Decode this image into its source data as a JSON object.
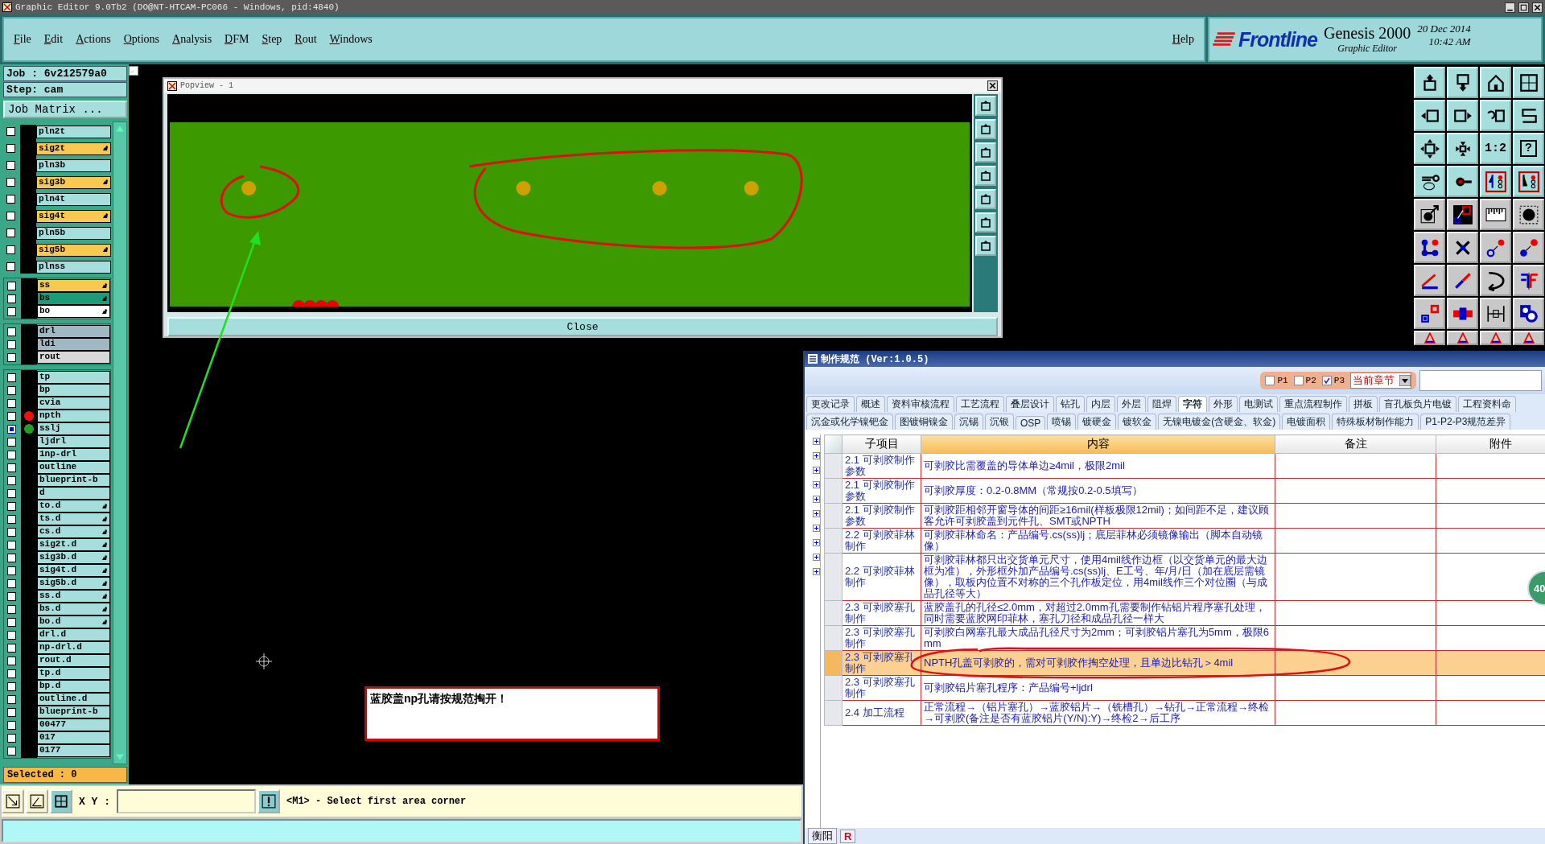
{
  "title_bar": {
    "title": "Graphic Editor 9.0Tb2 (DO@NT-HTCAM-PC066 - Windows, pid:4840)"
  },
  "menu": [
    "File",
    "Edit",
    "Actions",
    "Options",
    "Analysis",
    "DFM",
    "Step",
    "Rout",
    "Windows"
  ],
  "help": "Help",
  "brand": {
    "logo": "Frontline",
    "product": "Genesis 2000",
    "subtitle": "Graphic Editor",
    "date": "20 Dec 2014",
    "time": "10:42 AM"
  },
  "job_panel": {
    "job": "Job : 6v212579a0",
    "step": "Step: cam",
    "matrix_button": "Job Matrix ...",
    "selected": "Selected : 0"
  },
  "layer_groups": [
    {
      "spaced": true,
      "layers": [
        {
          "name": "pln2t",
          "kind": "board",
          "hand": false,
          "selected": false
        },
        {
          "name": "sig2t",
          "kind": "signal",
          "hand": true,
          "selected": false
        },
        {
          "name": "pln3b",
          "kind": "board",
          "hand": false,
          "selected": false
        },
        {
          "name": "sig3b",
          "kind": "signal",
          "hand": true,
          "selected": false
        },
        {
          "name": "pln4t",
          "kind": "board",
          "hand": false,
          "selected": false
        },
        {
          "name": "sig4t",
          "kind": "signal",
          "hand": true,
          "selected": false
        },
        {
          "name": "pln5b",
          "kind": "board",
          "hand": false,
          "selected": false
        },
        {
          "name": "sig5b",
          "kind": "signal",
          "hand": true,
          "selected": false
        },
        {
          "name": "plnss",
          "kind": "board",
          "hand": false,
          "selected": false
        }
      ]
    },
    {
      "spaced": false,
      "layers": [
        {
          "name": "ss",
          "kind": "signal",
          "hand": true,
          "selected": false
        },
        {
          "name": "bs",
          "kind": "mask",
          "hand": true,
          "selected": false
        },
        {
          "name": "bo",
          "kind": "silk",
          "hand": true,
          "selected": false
        }
      ]
    },
    {
      "spaced": false,
      "layers": [
        {
          "name": "drl",
          "kind": "drill",
          "hand": false,
          "selected": false
        },
        {
          "name": "ldi",
          "kind": "drill",
          "hand": false,
          "selected": false
        },
        {
          "name": "rout",
          "kind": "rout",
          "hand": false,
          "selected": false
        }
      ]
    },
    {
      "spaced": false,
      "layers": [
        {
          "name": "tp",
          "kind": "board",
          "hand": false,
          "selected": false
        },
        {
          "name": "bp",
          "kind": "board",
          "hand": false,
          "selected": false
        },
        {
          "name": "cvia",
          "kind": "board",
          "hand": false,
          "selected": false
        },
        {
          "name": "npth",
          "kind": "board",
          "hand": false,
          "selected": false,
          "color": "#ee1111"
        },
        {
          "name": "sslj",
          "kind": "board",
          "hand": false,
          "selected": true,
          "color": "#22a022"
        },
        {
          "name": "ljdrl",
          "kind": "board",
          "hand": false,
          "selected": false
        },
        {
          "name": "1np-drl",
          "kind": "board",
          "hand": false,
          "selected": false
        },
        {
          "name": "outline",
          "kind": "board",
          "hand": false,
          "selected": false
        },
        {
          "name": "blueprint-b",
          "kind": "board",
          "hand": false,
          "selected": false
        },
        {
          "name": "d",
          "kind": "board",
          "hand": false,
          "selected": false
        },
        {
          "name": "to.d",
          "kind": "board",
          "hand": true,
          "selected": false
        },
        {
          "name": "ts.d",
          "kind": "board",
          "hand": true,
          "selected": false
        },
        {
          "name": "cs.d",
          "kind": "board",
          "hand": true,
          "selected": false
        },
        {
          "name": "sig2t.d",
          "kind": "board",
          "hand": true,
          "selected": false
        },
        {
          "name": "sig3b.d",
          "kind": "board",
          "hand": true,
          "selected": false
        },
        {
          "name": "sig4t.d",
          "kind": "board",
          "hand": true,
          "selected": false
        },
        {
          "name": "sig5b.d",
          "kind": "board",
          "hand": true,
          "selected": false
        },
        {
          "name": "ss.d",
          "kind": "board",
          "hand": true,
          "selected": false
        },
        {
          "name": "bs.d",
          "kind": "board",
          "hand": true,
          "selected": false
        },
        {
          "name": "bo.d",
          "kind": "board",
          "hand": true,
          "selected": false
        },
        {
          "name": "drl.d",
          "kind": "board",
          "hand": false,
          "selected": false
        },
        {
          "name": "np-drl.d",
          "kind": "board",
          "hand": false,
          "selected": false
        },
        {
          "name": "rout.d",
          "kind": "board",
          "hand": false,
          "selected": false
        },
        {
          "name": "tp.d",
          "kind": "board",
          "hand": false,
          "selected": false
        },
        {
          "name": "bp.d",
          "kind": "board",
          "hand": false,
          "selected": false
        },
        {
          "name": "outline.d",
          "kind": "board",
          "hand": false,
          "selected": false
        },
        {
          "name": "blueprint-b",
          "kind": "board",
          "hand": false,
          "selected": false
        },
        {
          "name": "00477",
          "kind": "board",
          "hand": false,
          "selected": false
        },
        {
          "name": "017",
          "kind": "board",
          "hand": false,
          "selected": false
        },
        {
          "name": "0177",
          "kind": "board",
          "hand": false,
          "selected": false
        }
      ]
    }
  ],
  "canvas_message": "蓝胶盖np孔请按规范掏开！",
  "toolbar": [
    {
      "kind": "box-arrow-up"
    },
    {
      "kind": "box-arrow-down"
    },
    {
      "kind": "house"
    },
    {
      "kind": "grid-window"
    },
    {
      "kind": "box-arrow-left"
    },
    {
      "kind": "box-arrow-right"
    },
    {
      "kind": "undo"
    },
    {
      "kind": "zigzag"
    },
    {
      "kind": "box-arrows-out"
    },
    {
      "kind": "box-arrows-in"
    },
    {
      "kind": "text",
      "label": "1:2"
    },
    {
      "kind": "framed-text",
      "label": "?"
    },
    {
      "kind": "wrench"
    },
    {
      "kind": "pad-line"
    },
    {
      "kind": "circuit"
    },
    {
      "kind": "circuit-alt"
    },
    {
      "kind": "dot-arrow"
    },
    {
      "kind": "snap"
    },
    {
      "kind": "ruler"
    },
    {
      "kind": "dot"
    },
    {
      "kind": "nodes"
    },
    {
      "kind": "cross"
    },
    {
      "kind": "ring-link"
    },
    {
      "kind": "dot-link"
    },
    {
      "kind": "angle"
    },
    {
      "kind": "slash"
    },
    {
      "kind": "curve"
    },
    {
      "kind": "mirror"
    },
    {
      "kind": "square-link"
    },
    {
      "kind": "bar"
    },
    {
      "kind": "measure"
    },
    {
      "kind": "blob"
    },
    {
      "kind": "triangle"
    },
    {
      "kind": "triangle"
    },
    {
      "kind": "triangle"
    },
    {
      "kind": "triangle"
    }
  ],
  "bottom_bar": {
    "xy_label": "X Y :",
    "message": "<M1> - Select first area corner"
  },
  "popview": {
    "title": "Popview - 1",
    "close_button": "Close"
  },
  "spec_window": {
    "title": "制作规范 (Ver:1.0.5)",
    "filters": [
      {
        "label": "P1",
        "checked": false
      },
      {
        "label": "P2",
        "checked": false
      },
      {
        "label": "P3",
        "checked": true
      }
    ],
    "chapter_dropdown": "当前章节",
    "tab_rows": [
      [
        {
          "label": "更改记录",
          "selected": false
        },
        {
          "label": "概述",
          "selected": false
        },
        {
          "label": "资料审核流程",
          "selected": false
        },
        {
          "label": "工艺流程",
          "selected": false
        },
        {
          "label": "叠层设计",
          "selected": false
        },
        {
          "label": "钻孔",
          "selected": false
        },
        {
          "label": "内层",
          "selected": false
        },
        {
          "label": "外层",
          "selected": false
        },
        {
          "label": "阻焊",
          "selected": false
        },
        {
          "label": "字符",
          "selected": true
        },
        {
          "label": "外形",
          "selected": false
        },
        {
          "label": "电测试",
          "selected": false
        },
        {
          "label": "重点流程制作",
          "selected": false
        },
        {
          "label": "拼板",
          "selected": false
        },
        {
          "label": "盲孔板负片电镀",
          "selected": false
        },
        {
          "label": "工程资料命",
          "selected": false
        }
      ],
      [
        {
          "label": "沉金或化学镍钯金",
          "selected": false
        },
        {
          "label": "图镀铜镍金",
          "selected": false
        },
        {
          "label": "沉锡",
          "selected": false
        },
        {
          "label": "沉银",
          "selected": false
        },
        {
          "label": "OSP",
          "selected": false
        },
        {
          "label": "喷锡",
          "selected": false
        },
        {
          "label": "镀硬金",
          "selected": false
        },
        {
          "label": "镀软金",
          "selected": false
        },
        {
          "label": "无镍电镀金(含硬金、软金)",
          "selected": false
        },
        {
          "label": "电镀面积",
          "selected": false
        },
        {
          "label": "特殊板材制作能力",
          "selected": false
        },
        {
          "label": "P1-P2-P3规范差异",
          "selected": false
        }
      ]
    ],
    "columns": [
      "子项目",
      "内容",
      "备注",
      "附件"
    ],
    "rows": [
      {
        "item": "2.1 可剥胶制作参数",
        "content": "可剥胶比需覆盖的导体单边≥4mil，极限2mil",
        "selected": false,
        "circled": false
      },
      {
        "item": "2.1 可剥胶制作参数",
        "content": "可剥胶厚度：0.2-0.8MM（常规按0.2-0.5填写）",
        "selected": false,
        "circled": false
      },
      {
        "item": "2.1 可剥胶制作参数",
        "content": "可剥胶距相邻开窗导体的间距≥16mil(样板极限12mil)；如间距不足，建议顾客允许可剥胶盖到元件孔、SMT或NPTH",
        "selected": false,
        "circled": false
      },
      {
        "item": "2.2 可剥胶菲林制作",
        "content": "可剥胶菲林命名：产品编号.cs(ss)lj；底层菲林必须镜像输出（脚本自动镜像）",
        "selected": false,
        "circled": false
      },
      {
        "item": "2.2 可剥胶菲林制作",
        "content": "可剥胶菲林都只出交货单元尺寸，使用4mil线作边框（以交货单元的最大边框为准），外形框外加产品编号.cs(ss)lj、E工号、年/月/日（加在底层需镜像），取板内位置不对称的三个孔作板定位，用4mil线作三个对位圈（与成品孔径等大）",
        "selected": false,
        "circled": false
      },
      {
        "item": "2.3 可剥胶塞孔制作",
        "content": "蓝胶盖孔的孔径≤2.0mm，对超过2.0mm孔需要制作钻铝片程序塞孔处理，同时需要蓝胶网印菲林，塞孔刀径和成品孔径一样大",
        "selected": false,
        "circled": false
      },
      {
        "item": "2.3 可剥胶塞孔制作",
        "content": "可剥胶白网塞孔最大成品孔径尺寸为2mm；可剥胶铝片塞孔为5mm，极限6mm",
        "selected": false,
        "circled": false
      },
      {
        "item": "2.3 可剥胶塞孔制作",
        "content": "NPTH孔盖可剥胶的，需对可剥胶作掏空处理，且单边比钻孔＞4mil",
        "selected": true,
        "circled": true
      },
      {
        "item": "2.3 可剥胶塞孔制作",
        "content": "可剥胶铝片塞孔程序：产品编号+ljdrl",
        "selected": false,
        "circled": false
      },
      {
        "item": "2.4 加工流程",
        "content": "正常流程→（铝片塞孔）→蓝胶铝片→（铣槽孔）→钻孔→正常流程→终检→可剥胶(备注是否有蓝胶铝片(Y/N):Y)→终检2→后工序",
        "selected": false,
        "circled": false
      }
    ],
    "side_badge": "40",
    "bottom_tabs": [
      {
        "label": "衡阳",
        "kind": "plain"
      },
      {
        "label": "R",
        "kind": "red"
      }
    ]
  }
}
